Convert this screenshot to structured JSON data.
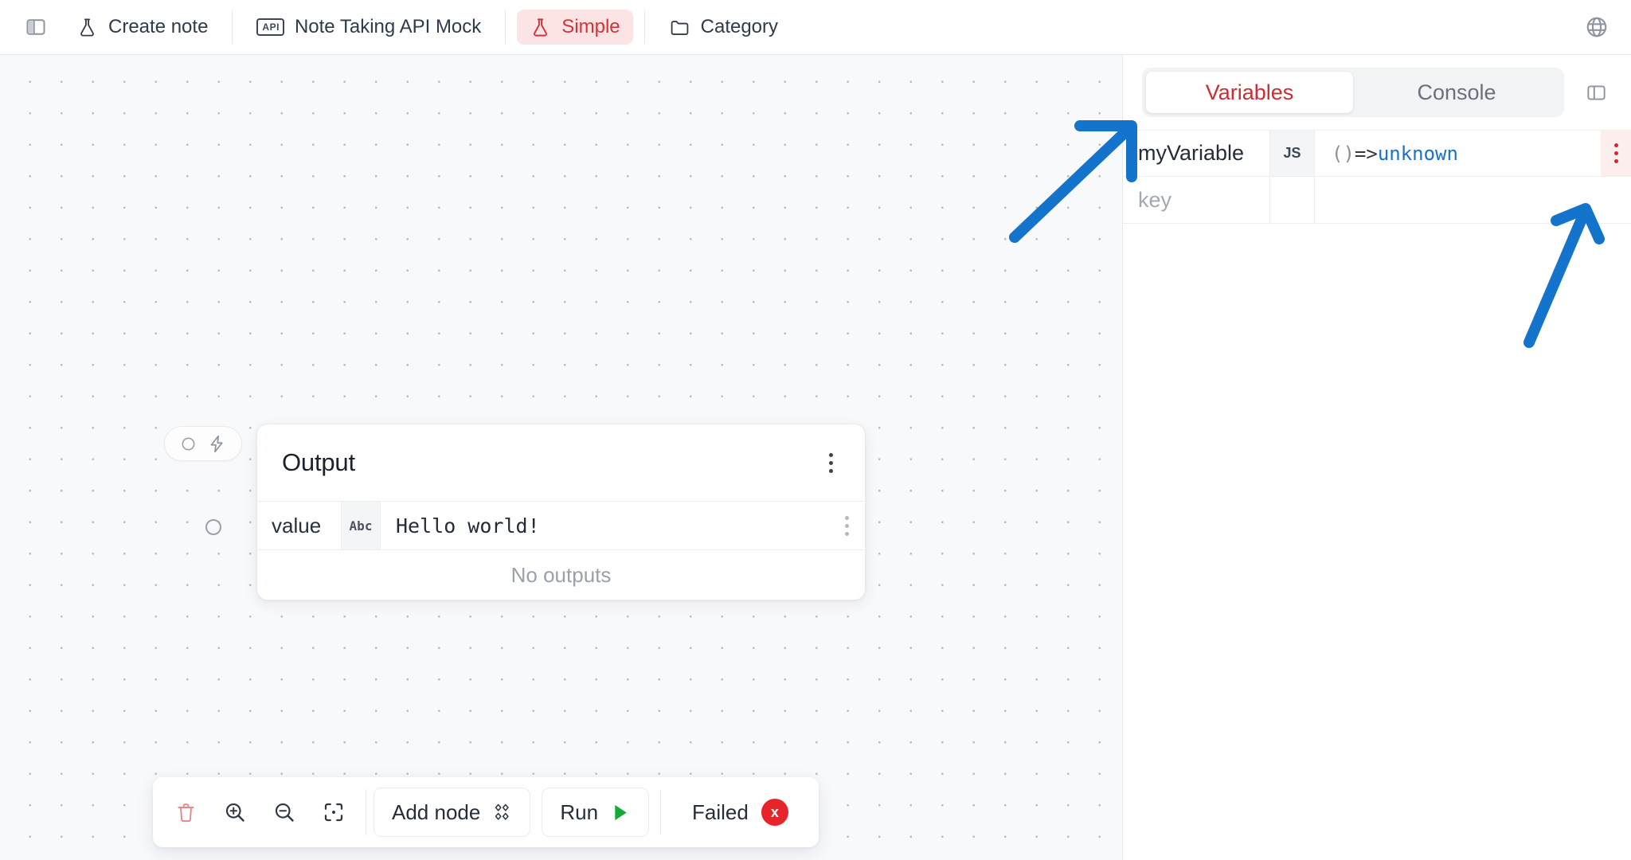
{
  "topbar": {
    "sidebar_toggle_icon": "panel-left-icon",
    "items": [
      {
        "id": "create-note",
        "label": "Create note",
        "icon": "flask-icon",
        "active": false
      },
      {
        "id": "note-taking-api-mock",
        "label": "Note Taking API Mock",
        "icon": "api-badge-icon",
        "active": false
      },
      {
        "id": "simple",
        "label": "Simple",
        "icon": "flask-icon",
        "active": true
      },
      {
        "id": "category",
        "label": "Category",
        "icon": "folder-icon",
        "active": false
      }
    ],
    "globe_icon": "globe-icon"
  },
  "canvas": {
    "port_badge": {
      "circle_icon": "connection-port-icon",
      "bolt_icon": "lightning-bolt-icon"
    },
    "standalone_port_icon": "connection-port-icon",
    "node": {
      "title": "Output",
      "menu_icon": "kebab-menu-icon",
      "rows": [
        {
          "key": "value",
          "type_badge": "Abc",
          "value": "Hello world!",
          "menu_icon": "kebab-menu-icon"
        }
      ],
      "footer_text": "No outputs"
    }
  },
  "bottom_toolbar": {
    "delete_icon": "trash-icon",
    "zoom_in_icon": "zoom-in-icon",
    "zoom_out_icon": "zoom-out-icon",
    "fit_view_icon": "fit-view-icon",
    "add_node_label": "Add node",
    "add_node_icon": "diamond-grid-icon",
    "run_label": "Run",
    "run_icon": "play-icon",
    "status_label": "Failed",
    "status_symbol": "x",
    "status_color": "#e8242b"
  },
  "right_panel": {
    "tabs": [
      {
        "id": "variables",
        "label": "Variables",
        "active": true
      },
      {
        "id": "console",
        "label": "Console",
        "active": false
      }
    ],
    "collapse_icon": "panel-right-icon",
    "variables": [
      {
        "name": "myVariable",
        "type_badge": "JS",
        "value_prefix": "() ",
        "value_arrow": "=> ",
        "value_result": "unknown",
        "menu_icon": "kebab-menu-icon",
        "menu_highlighted": true
      },
      {
        "name": "key",
        "name_is_placeholder": true,
        "type_badge": "",
        "value_prefix": "",
        "value_arrow": "",
        "value_result": "",
        "menu_icon": "",
        "menu_highlighted": false
      }
    ]
  },
  "annotations": {
    "arrow_color": "#1474cc",
    "arrows": [
      {
        "id": "arrow-to-variables-tab",
        "target": "variables-tab"
      },
      {
        "id": "arrow-to-variable-row-menu",
        "target": "variable-row-menu-button"
      }
    ]
  },
  "colors": {
    "accent_red": "#cf2b32",
    "accent_red_soft": "#fde4e4",
    "link_blue": "#1a73c7",
    "success_green": "#17a83a",
    "canvas_bg": "#f8f9fb"
  }
}
